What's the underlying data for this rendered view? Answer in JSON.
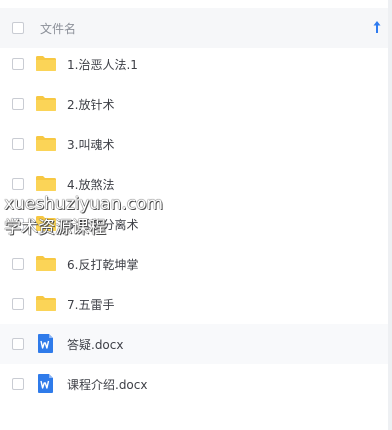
{
  "header": {
    "name_label": "文件名",
    "sort_icon": "arrow-up-icon",
    "sort_color": "#2e7bf0"
  },
  "files": [
    {
      "name": "1.治恶人法.1",
      "type": "folder"
    },
    {
      "name": "2.放针术",
      "type": "folder"
    },
    {
      "name": "3.叫魂术",
      "type": "folder"
    },
    {
      "name": "4.放煞法",
      "type": "folder"
    },
    {
      "name": "5.拆散分离术",
      "type": "folder"
    },
    {
      "name": "6.反打乾坤掌",
      "type": "folder"
    },
    {
      "name": "7.五雷手",
      "type": "folder"
    },
    {
      "name": "答疑.docx",
      "type": "docx"
    },
    {
      "name": "课程介绍.docx",
      "type": "docx"
    }
  ],
  "watermark": {
    "line1": "xueshuziyuan.com",
    "line2": "学术资源课程"
  },
  "colors": {
    "folder": "#f7c843",
    "docx": "#2f7bea",
    "accent": "#2e7bf0"
  }
}
